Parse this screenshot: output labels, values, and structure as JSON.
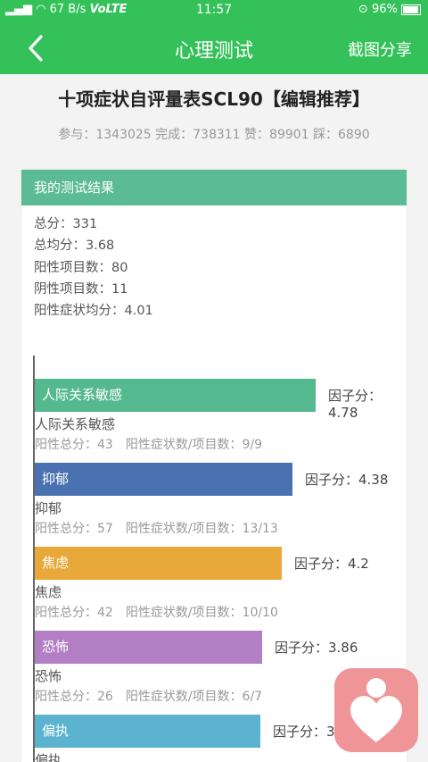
{
  "status_bar": {
    "signal_text": "67 B/s",
    "network_text": "VoLTE",
    "time": "11:57",
    "battery": "96%"
  },
  "nav": {
    "title": "心理测试",
    "share_label": "截图分享"
  },
  "test": {
    "title": "十项症状自评量表SCL90【编辑推荐】",
    "stats": "参与：1343025 完成：738311 赞：89901 踩：6890"
  },
  "result": {
    "header": "我的测试结果",
    "summary": [
      "总分：331",
      "总均分：3.68",
      "阳性项目数：80",
      "阴性项目数：11",
      "阳性症状均分：4.01"
    ]
  },
  "chart_data": {
    "type": "bar",
    "orientation": "horizontal",
    "categories": [
      "人际关系敏感",
      "抑郁",
      "焦虑",
      "恐怖",
      "偏执"
    ],
    "values": [
      4.78,
      4.38,
      4.2,
      3.86,
      3.83
    ],
    "xlim": [
      0,
      5
    ]
  },
  "factors": [
    {
      "name": "人际关系敏感",
      "score_text": "因子分：4.78",
      "detail": "阳性总分：43　阳性症状数/项目数：9/9",
      "color": "#55b98f"
    },
    {
      "name": "抑郁",
      "score_text": "因子分：4.38",
      "detail": "阳性总分：57　阳性症状数/项目数：13/13",
      "color": "#4a72b0"
    },
    {
      "name": "焦虑",
      "score_text": "因子分：4.2",
      "detail": "阳性总分：42　阳性症状数/项目数：10/10",
      "color": "#e8a83a"
    },
    {
      "name": "恐怖",
      "score_text": "因子分：3.86",
      "detail": "阳性总分：26　阳性症状数/项目数：6/7",
      "color": "#b27fc4"
    },
    {
      "name": "偏执",
      "score_text": "因子分：3.83",
      "detail": "",
      "color": "#5bb3cf"
    }
  ],
  "colors": {
    "brand_green": "#35c15a",
    "card_header": "#5bbb94",
    "app_icon_bg": "#ef9598"
  },
  "icons": {
    "back": "back-chevron-icon",
    "app": "heart-person-icon"
  }
}
